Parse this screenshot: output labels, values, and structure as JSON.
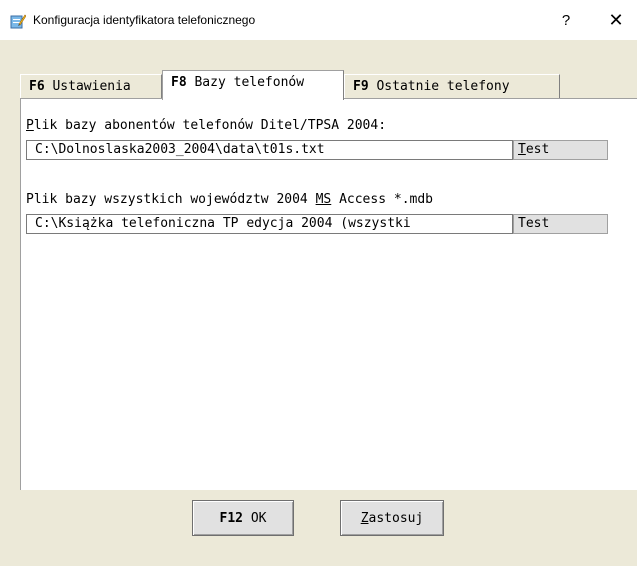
{
  "window": {
    "title": "Konfiguracja identyfikatora telefonicznego",
    "help_label": "?",
    "close_label": "✕"
  },
  "tabs": [
    {
      "key": "F6",
      "label": " Ustawienia"
    },
    {
      "key": "F8",
      "label": " Bazy telefonów"
    },
    {
      "key": "F9",
      "label": " Ostatnie telefony"
    }
  ],
  "active_tab": 1,
  "fields": [
    {
      "label_mnemonic": "P",
      "label_rest": "lik bazy abonentów telefonów Ditel/TPSA 2004:",
      "value": "C:\\Dolnoslaska2003_2004\\data\\t01s.txt",
      "button_mnemonic": "T",
      "button_rest": "est"
    },
    {
      "label_pre": "Plik bazy wszystkich województw 2004 ",
      "label_mnemonic": "MS",
      "label_post": " Access *.mdb",
      "value": "C:\\Książka telefoniczna TP edycja 2004 (wszystki",
      "button_label": "Test"
    }
  ],
  "buttons": {
    "ok_key": "F12",
    "ok_label": " OK",
    "apply_mnemonic": "Z",
    "apply_rest": "astosuj"
  },
  "colors": {
    "dialog_bg": "#ece9d8",
    "panel_bg": "#ffffff",
    "button_bg": "#e1e1e1"
  },
  "icons": {
    "app": "notepad-pencil-icon",
    "overflow": "triangle-right-icon"
  }
}
